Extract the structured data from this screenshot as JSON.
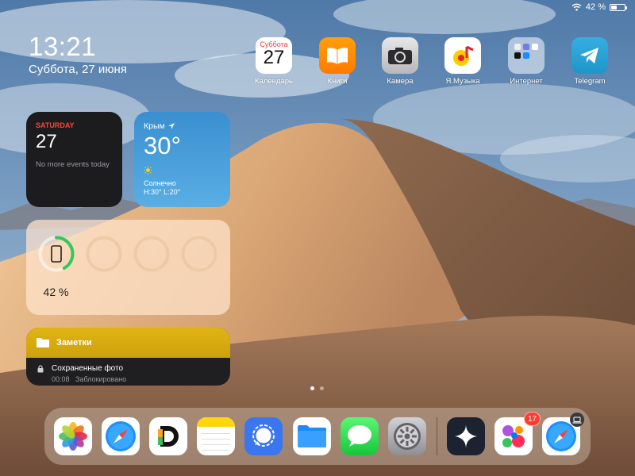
{
  "status": {
    "battery_text": "42 %",
    "battery_level": 0.42,
    "icons": [
      "wifi-icon",
      "battery-icon"
    ]
  },
  "clock": {
    "time": "13:21",
    "date": "Суббота, 27 июня"
  },
  "apps": [
    {
      "label": "Календарь",
      "icon": "calendar-icon",
      "weekday": "Суббота",
      "day": "27"
    },
    {
      "label": "Книги",
      "icon": "books-icon"
    },
    {
      "label": "Камера",
      "icon": "camera-icon"
    },
    {
      "label": "Я.Музыка",
      "icon": "yandex-music-icon"
    },
    {
      "label": "Интернет",
      "icon": "folder-icon"
    },
    {
      "label": "Telegram",
      "icon": "telegram-icon"
    }
  ],
  "widgets": {
    "calendar": {
      "weekday": "SATURDAY",
      "day": "27",
      "events": "No more events today"
    },
    "weather": {
      "city": "Крым",
      "temp": "30°",
      "condition": "Солнечно",
      "high_low": "H:30° L:20°"
    },
    "battery": {
      "percent_text": "42 %",
      "level": 0.42
    },
    "notes": {
      "folder": "Заметки",
      "note_title": "Сохраненные фото",
      "note_time": "00:08",
      "note_status": "Заблокировано"
    }
  },
  "page_dots": {
    "count": 2,
    "active": 0
  },
  "dock": {
    "apps": [
      {
        "name": "photos",
        "icon": "photos-icon"
      },
      {
        "name": "safari",
        "icon": "safari-icon"
      },
      {
        "name": "day-one",
        "icon": "day-one-icon"
      },
      {
        "name": "notes",
        "icon": "notes-icon"
      },
      {
        "name": "signal",
        "icon": "signal-icon"
      },
      {
        "name": "files",
        "icon": "files-icon"
      },
      {
        "name": "messages",
        "icon": "messages-icon"
      },
      {
        "name": "settings",
        "icon": "settings-icon"
      },
      {
        "name": "perplexity",
        "icon": "sparkle-icon"
      },
      {
        "name": "game-center",
        "icon": "bubbles-icon"
      },
      {
        "name": "safari-handoff",
        "icon": "safari-icon"
      }
    ],
    "badge": "17"
  },
  "colors": {
    "accent_red": "#ff453a",
    "battery_green": "#34c759",
    "notes_yellow": "#e1b413",
    "weather_blue": "#3a8fd0"
  }
}
